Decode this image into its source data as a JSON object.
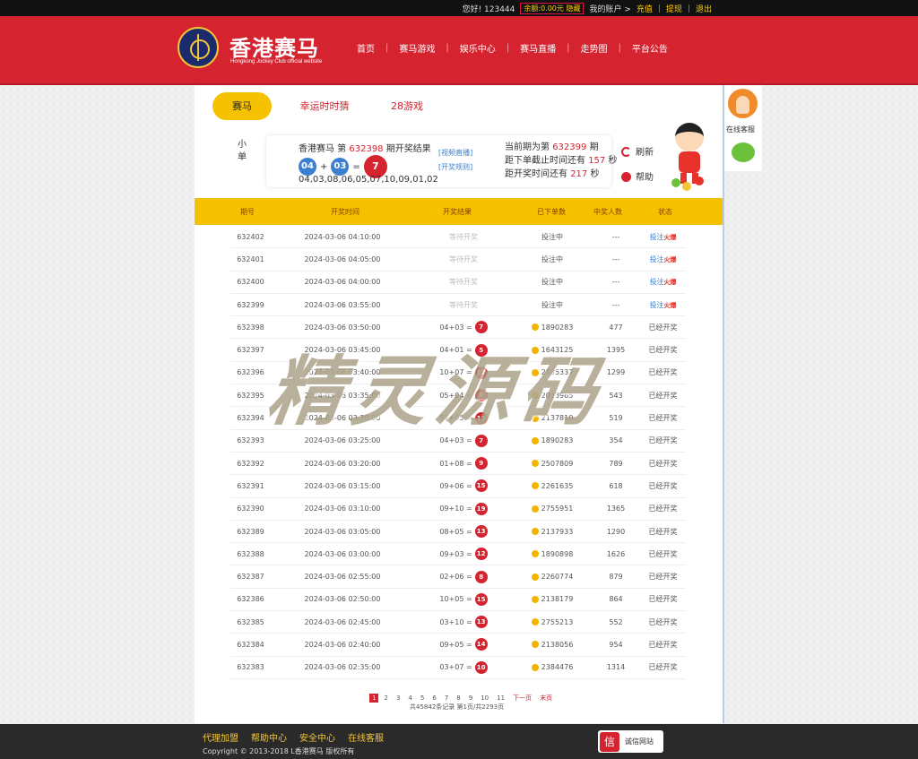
{
  "topbar": {
    "greeting": "您好! 123444",
    "balance": "余额:0.00元 隐藏",
    "account": "我的账户 >",
    "deposit": "充值",
    "withdraw": "提现",
    "logout": "退出"
  },
  "header": {
    "brand": "香港赛马",
    "brand_sub": "Hongkong Jockey Club official website",
    "nav": [
      "首页",
      "赛马游戏",
      "娱乐中心",
      "赛马直播",
      "走势图",
      "平台公告"
    ]
  },
  "tabs": [
    "赛马",
    "幸运时时猜",
    "28游戏"
  ],
  "side_label": "小单",
  "result": {
    "title_prefix": "香港赛马 第",
    "period": "632398",
    "title_suffix": "期开奖结果",
    "ball1": "04",
    "plus": "+",
    "ball2": "03",
    "equals": "=",
    "sum": "7",
    "numbers": "04,03,08,06,05,07,10,09,01,02",
    "link_video": "[视频直播]",
    "link_rules": "[开奖规则]",
    "current_prefix": "当前期为第",
    "current_period": "632399",
    "current_suffix": "期",
    "deadline_prefix": "距下单截止时间还有",
    "deadline_secs": "157",
    "draw_prefix": "距开奖时间还有",
    "draw_secs": "217",
    "secs_unit": "秒"
  },
  "actions": {
    "refresh": "刷新",
    "help": "帮助"
  },
  "table": {
    "headers": [
      "期号",
      "开奖时间",
      "开奖结果",
      "已下单数",
      "中奖人数",
      "状态"
    ],
    "pending_rows": [
      {
        "period": "632402",
        "time": "2024-03-06 04:10:00",
        "result": "等待开奖",
        "orders": "投注中",
        "winners": "---",
        "status": "投注",
        "hot": "火爆"
      },
      {
        "period": "632401",
        "time": "2024-03-06 04:05:00",
        "result": "等待开奖",
        "orders": "投注中",
        "winners": "---",
        "status": "投注",
        "hot": "火爆"
      },
      {
        "period": "632400",
        "time": "2024-03-06 04:00:00",
        "result": "等待开奖",
        "orders": "投注中",
        "winners": "---",
        "status": "投注",
        "hot": "火爆"
      },
      {
        "period": "632399",
        "time": "2024-03-06 03:55:00",
        "result": "等待开奖",
        "orders": "投注中",
        "winners": "---",
        "status": "投注",
        "hot": "火爆"
      }
    ],
    "rows": [
      {
        "period": "632398",
        "time": "2024-03-06 03:50:00",
        "expr": "04+03 =",
        "sum": "7",
        "orders": "1890283",
        "winners": "477",
        "status": "已经开奖"
      },
      {
        "period": "632397",
        "time": "2024-03-06 03:45:00",
        "expr": "04+01 =",
        "sum": "5",
        "orders": "1643125",
        "winners": "1395",
        "status": "已经开奖"
      },
      {
        "period": "632396",
        "time": "2024-03-06 03:40:00",
        "expr": "10+07 =",
        "sum": "17",
        "orders": "2385337",
        "winners": "1299",
        "status": "已经开奖"
      },
      {
        "period": "632395",
        "time": "2024-03-06 03:35:00",
        "expr": "05+04 =",
        "sum": "9",
        "orders": "2013965",
        "winners": "543",
        "status": "已经开奖"
      },
      {
        "period": "632394",
        "time": "2024-03-06 03:30:00",
        "expr": "07+05 =",
        "sum": "12",
        "orders": "2137810",
        "winners": "519",
        "status": "已经开奖"
      },
      {
        "period": "632393",
        "time": "2024-03-06 03:25:00",
        "expr": "04+03 =",
        "sum": "7",
        "orders": "1890283",
        "winners": "354",
        "status": "已经开奖"
      },
      {
        "period": "632392",
        "time": "2024-03-06 03:20:00",
        "expr": "01+08 =",
        "sum": "9",
        "orders": "2507809",
        "winners": "789",
        "status": "已经开奖"
      },
      {
        "period": "632391",
        "time": "2024-03-06 03:15:00",
        "expr": "09+06 =",
        "sum": "15",
        "orders": "2261635",
        "winners": "618",
        "status": "已经开奖"
      },
      {
        "period": "632390",
        "time": "2024-03-06 03:10:00",
        "expr": "09+10 =",
        "sum": "19",
        "orders": "2755951",
        "winners": "1365",
        "status": "已经开奖"
      },
      {
        "period": "632389",
        "time": "2024-03-06 03:05:00",
        "expr": "08+05 =",
        "sum": "13",
        "orders": "2137933",
        "winners": "1290",
        "status": "已经开奖"
      },
      {
        "period": "632388",
        "time": "2024-03-06 03:00:00",
        "expr": "09+03 =",
        "sum": "12",
        "orders": "1890898",
        "winners": "1626",
        "status": "已经开奖"
      },
      {
        "period": "632387",
        "time": "2024-03-06 02:55:00",
        "expr": "02+06 =",
        "sum": "8",
        "orders": "2260774",
        "winners": "879",
        "status": "已经开奖"
      },
      {
        "period": "632386",
        "time": "2024-03-06 02:50:00",
        "expr": "10+05 =",
        "sum": "15",
        "orders": "2138179",
        "winners": "864",
        "status": "已经开奖"
      },
      {
        "period": "632385",
        "time": "2024-03-06 02:45:00",
        "expr": "03+10 =",
        "sum": "13",
        "orders": "2755213",
        "winners": "552",
        "status": "已经开奖"
      },
      {
        "period": "632384",
        "time": "2024-03-06 02:40:00",
        "expr": "09+05 =",
        "sum": "14",
        "orders": "2138056",
        "winners": "954",
        "status": "已经开奖"
      },
      {
        "period": "632383",
        "time": "2024-03-06 02:35:00",
        "expr": "03+07 =",
        "sum": "10",
        "orders": "2384476",
        "winners": "1314",
        "status": "已经开奖"
      }
    ]
  },
  "pager": {
    "pages": [
      "1",
      "2",
      "3",
      "4",
      "5",
      "6",
      "7",
      "8",
      "9",
      "10",
      "11"
    ],
    "current": "1",
    "next": "下一页",
    "last": "末页",
    "info": "共45842条记录 第1页/共2293页"
  },
  "watermark": "精灵源码",
  "widget": {
    "label": "在线客服"
  },
  "footer": {
    "links": [
      "代理加盟",
      "帮助中心",
      "安全中心",
      "在线客服"
    ],
    "copyright": "Copyright © 2013-2018 L香港赛马 版权所有",
    "badge_seal": "信",
    "badge_text": "诚信网站"
  },
  "colors": {
    "brand_red": "#d5232f",
    "accent_yellow": "#f6c200",
    "ball_blue": "#3a7fd0"
  }
}
